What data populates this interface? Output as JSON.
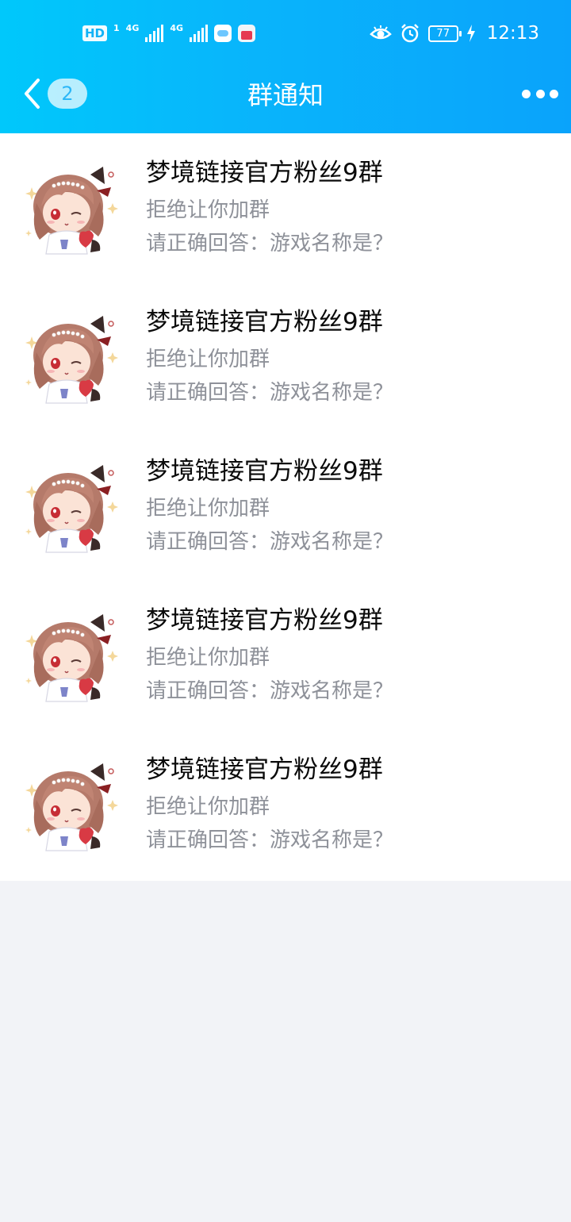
{
  "status_bar": {
    "hd": "HD",
    "sim1": "1",
    "net1": "4G",
    "net2": "4G",
    "battery": "77",
    "time": "12:13"
  },
  "nav": {
    "back_count": "2",
    "title": "群通知"
  },
  "colors": {
    "header_start": "#00c8fb",
    "header_end": "#0aa3fb",
    "background": "#f2f3f7",
    "secondary_text": "#8e9199"
  },
  "notifications": [
    {
      "group_name": "梦境链接官方粉丝9群",
      "status": "拒绝让你加群",
      "answer": "请正确回答：游戏名称是？"
    },
    {
      "group_name": "梦境链接官方粉丝9群",
      "status": "拒绝让你加群",
      "answer": "请正确回答：游戏名称是？"
    },
    {
      "group_name": "梦境链接官方粉丝9群",
      "status": "拒绝让你加群",
      "answer": "请正确回答：游戏名称是？"
    },
    {
      "group_name": "梦境链接官方粉丝9群",
      "status": "拒绝让你加群",
      "answer": "请正确回答：游戏名称是？"
    },
    {
      "group_name": "梦境链接官方粉丝9群",
      "status": "拒绝让你加群",
      "answer": "请正确回答：游戏名称是？"
    }
  ]
}
